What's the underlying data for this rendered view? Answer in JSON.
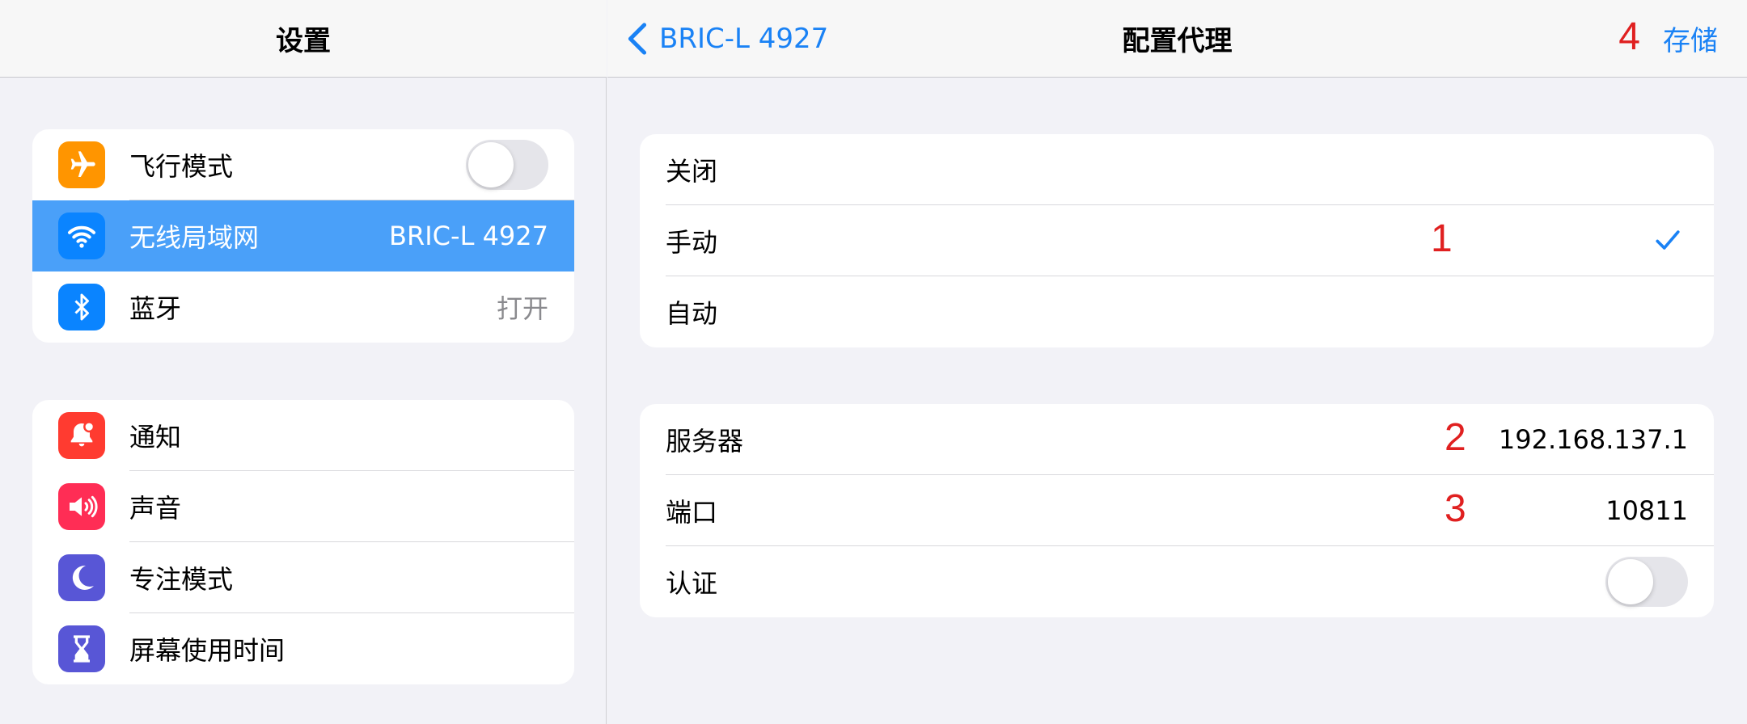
{
  "sidebar": {
    "title": "设置",
    "group1": [
      {
        "label": "飞行模式",
        "icon": "airplane-icon",
        "color": "#ff9500",
        "toggle": false
      },
      {
        "label": "无线局域网",
        "value": "BRIC-L 4927",
        "icon": "wifi-icon",
        "color": "#0a84ff",
        "selected": true
      },
      {
        "label": "蓝牙",
        "value": "打开",
        "icon": "bluetooth-icon",
        "color": "#0a84ff"
      }
    ],
    "group2": [
      {
        "label": "通知",
        "icon": "notification-bell-icon",
        "color": "#ff3b30"
      },
      {
        "label": "声音",
        "icon": "speaker-icon",
        "color": "#ff2d55"
      },
      {
        "label": "专注模式",
        "icon": "moon-icon",
        "color": "#5856d6"
      },
      {
        "label": "屏幕使用时间",
        "icon": "hourglass-icon",
        "color": "#5856d6"
      }
    ]
  },
  "detail": {
    "back_label": "BRIC-L 4927",
    "title": "配置代理",
    "save_label": "存储",
    "mode_options": [
      {
        "label": "关闭",
        "checked": false
      },
      {
        "label": "手动",
        "checked": true
      },
      {
        "label": "自动",
        "checked": false
      }
    ],
    "server_label": "服务器",
    "server_value": "192.168.137.1",
    "port_label": "端口",
    "port_value": "10811",
    "auth_label": "认证",
    "auth_enabled": false
  },
  "annotations": {
    "a1": "1",
    "a2": "2",
    "a3": "3",
    "a4": "4"
  },
  "colors": {
    "accent": "#1a82f5",
    "annotation": "#e02020",
    "selected_row": "#4aa0f9"
  }
}
